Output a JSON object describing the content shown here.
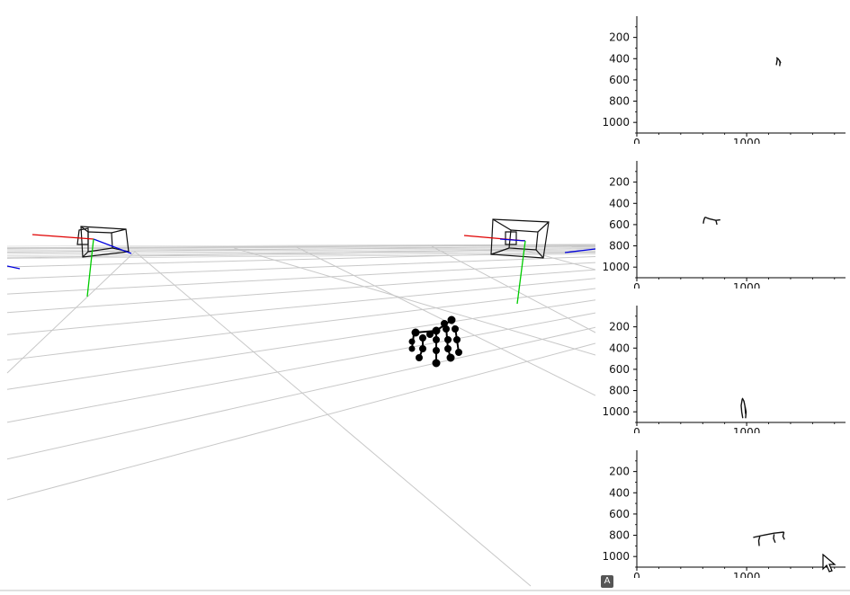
{
  "scene": {
    "grid_color": "#c8c8c8",
    "camera_color": "#111111",
    "axis_colors": {
      "x": "#e00000",
      "y": "#00cc00",
      "z": "#0000dd"
    },
    "skeleton_color": "#000000"
  },
  "plots": {
    "x_ticks": [
      "0",
      "1000"
    ],
    "y_ticks": [
      "200",
      "400",
      "600",
      "800",
      "1000"
    ],
    "xlim": [
      0,
      1900
    ],
    "ylim": [
      1100,
      0
    ],
    "line_color": "#111111"
  },
  "badge_label": "A",
  "cursor_icon": "arrow-cursor-icon",
  "chart_data": [
    {
      "type": "line",
      "x_ticks": [
        "0",
        "1000"
      ],
      "y_ticks": [
        "200",
        "400",
        "600",
        "800",
        "1000"
      ],
      "xlim": [
        0,
        1900
      ],
      "ylim": [
        1100,
        0
      ],
      "series": [
        {
          "x": [
            1270,
            1285,
            1300,
            1310
          ],
          "y": [
            390,
            400,
            420,
            440
          ]
        },
        {
          "x": [
            1280,
            1275,
            1270
          ],
          "y": [
            400,
            430,
            460
          ]
        },
        {
          "x": [
            1300,
            1305,
            1300
          ],
          "y": [
            420,
            440,
            470
          ]
        }
      ]
    },
    {
      "type": "line",
      "x_ticks": [
        "0",
        "1000"
      ],
      "y_ticks": [
        "200",
        "400",
        "600",
        "800",
        "1000"
      ],
      "xlim": [
        0,
        1900
      ],
      "ylim": [
        1100,
        0
      ],
      "series": [
        {
          "x": [
            620,
            660,
            720,
            760
          ],
          "y": [
            530,
            545,
            560,
            555
          ]
        },
        {
          "x": [
            620,
            610,
            605
          ],
          "y": [
            530,
            560,
            590
          ]
        },
        {
          "x": [
            720,
            725,
            730
          ],
          "y": [
            560,
            580,
            600
          ]
        }
      ]
    },
    {
      "type": "line",
      "x_ticks": [
        "0",
        "1000"
      ],
      "y_ticks": [
        "200",
        "400",
        "600",
        "800",
        "1000"
      ],
      "xlim": [
        0,
        1900
      ],
      "ylim": [
        1100,
        0
      ],
      "series": [
        {
          "x": [
            960,
            975,
            985,
            990
          ],
          "y": [
            870,
            900,
            950,
            1020
          ]
        },
        {
          "x": [
            960,
            950,
            955,
            965
          ],
          "y": [
            880,
            940,
            1000,
            1060
          ]
        },
        {
          "x": [
            985,
            995,
            990
          ],
          "y": [
            950,
            1000,
            1060
          ]
        }
      ]
    },
    {
      "type": "line",
      "x_ticks": [
        "0",
        "1000"
      ],
      "y_ticks": [
        "200",
        "400",
        "600",
        "800",
        "1000"
      ],
      "xlim": [
        0,
        1900
      ],
      "ylim": [
        1100,
        0
      ],
      "series": [
        {
          "x": [
            1060,
            1150,
            1250,
            1340
          ],
          "y": [
            820,
            800,
            780,
            770
          ]
        },
        {
          "x": [
            1120,
            1110,
            1115
          ],
          "y": [
            810,
            850,
            900
          ]
        },
        {
          "x": [
            1250,
            1245,
            1260
          ],
          "y": [
            790,
            830,
            870
          ]
        },
        {
          "x": [
            1340,
            1330,
            1345
          ],
          "y": [
            770,
            810,
            840
          ]
        }
      ]
    }
  ]
}
